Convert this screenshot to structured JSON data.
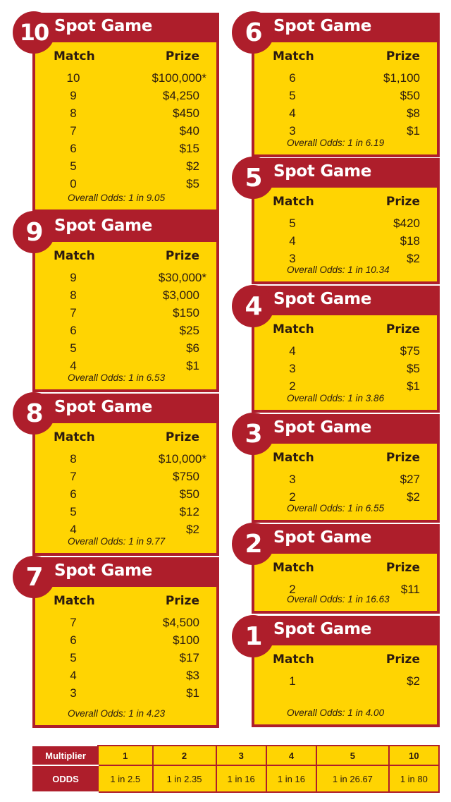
{
  "headers": {
    "match": "Match",
    "prize": "Prize"
  },
  "title_suffix": "Spot Game",
  "games": [
    {
      "spot": "10",
      "rows": [
        [
          "10",
          "$100,000*"
        ],
        [
          "9",
          "$4,250"
        ],
        [
          "8",
          "$450"
        ],
        [
          "7",
          "$40"
        ],
        [
          "6",
          "$15"
        ],
        [
          "5",
          "$2"
        ],
        [
          "0",
          "$5"
        ]
      ],
      "odds": "Overall Odds: 1 in 9.05"
    },
    {
      "spot": "9",
      "rows": [
        [
          "9",
          "$30,000*"
        ],
        [
          "8",
          "$3,000"
        ],
        [
          "7",
          "$150"
        ],
        [
          "6",
          "$25"
        ],
        [
          "5",
          "$6"
        ],
        [
          "4",
          "$1"
        ]
      ],
      "odds": "Overall Odds: 1 in 6.53"
    },
    {
      "spot": "8",
      "rows": [
        [
          "8",
          "$10,000*"
        ],
        [
          "7",
          "$750"
        ],
        [
          "6",
          "$50"
        ],
        [
          "5",
          "$12"
        ],
        [
          "4",
          "$2"
        ]
      ],
      "odds": "Overall Odds: 1 in 9.77"
    },
    {
      "spot": "7",
      "rows": [
        [
          "7",
          "$4,500"
        ],
        [
          "6",
          "$100"
        ],
        [
          "5",
          "$17"
        ],
        [
          "4",
          "$3"
        ],
        [
          "3",
          "$1"
        ]
      ],
      "odds": "Overall Odds: 1 in 4.23"
    },
    {
      "spot": "6",
      "rows": [
        [
          "6",
          "$1,100"
        ],
        [
          "5",
          "$50"
        ],
        [
          "4",
          "$8"
        ],
        [
          "3",
          "$1"
        ]
      ],
      "odds": "Overall Odds: 1 in 6.19"
    },
    {
      "spot": "5",
      "rows": [
        [
          "5",
          "$420"
        ],
        [
          "4",
          "$18"
        ],
        [
          "3",
          "$2"
        ]
      ],
      "odds": "Overall Odds: 1 in 10.34"
    },
    {
      "spot": "4",
      "rows": [
        [
          "4",
          "$75"
        ],
        [
          "3",
          "$5"
        ],
        [
          "2",
          "$1"
        ]
      ],
      "odds": "Overall Odds: 1 in 3.86"
    },
    {
      "spot": "3",
      "rows": [
        [
          "3",
          "$27"
        ],
        [
          "2",
          "$2"
        ]
      ],
      "odds": "Overall Odds: 1 in 6.55"
    },
    {
      "spot": "2",
      "rows": [
        [
          "2",
          "$11"
        ]
      ],
      "odds": "Overall Odds: 1 in 16.63"
    },
    {
      "spot": "1",
      "rows": [
        [
          "1",
          "$2"
        ]
      ],
      "odds": "Overall Odds: 1 in 4.00"
    }
  ],
  "multiplier": {
    "label": "Multiplier",
    "odds_label": "ODDS",
    "values": [
      "1",
      "2",
      "3",
      "4",
      "5",
      "10"
    ],
    "odds": [
      "1 in 2.5",
      "1 in 2.35",
      "1 in 16",
      "1 in 16",
      "1 in 26.67",
      "1 in 80"
    ]
  },
  "colors": {
    "red": "#ae1e2b",
    "yellow": "#ffd402"
  }
}
